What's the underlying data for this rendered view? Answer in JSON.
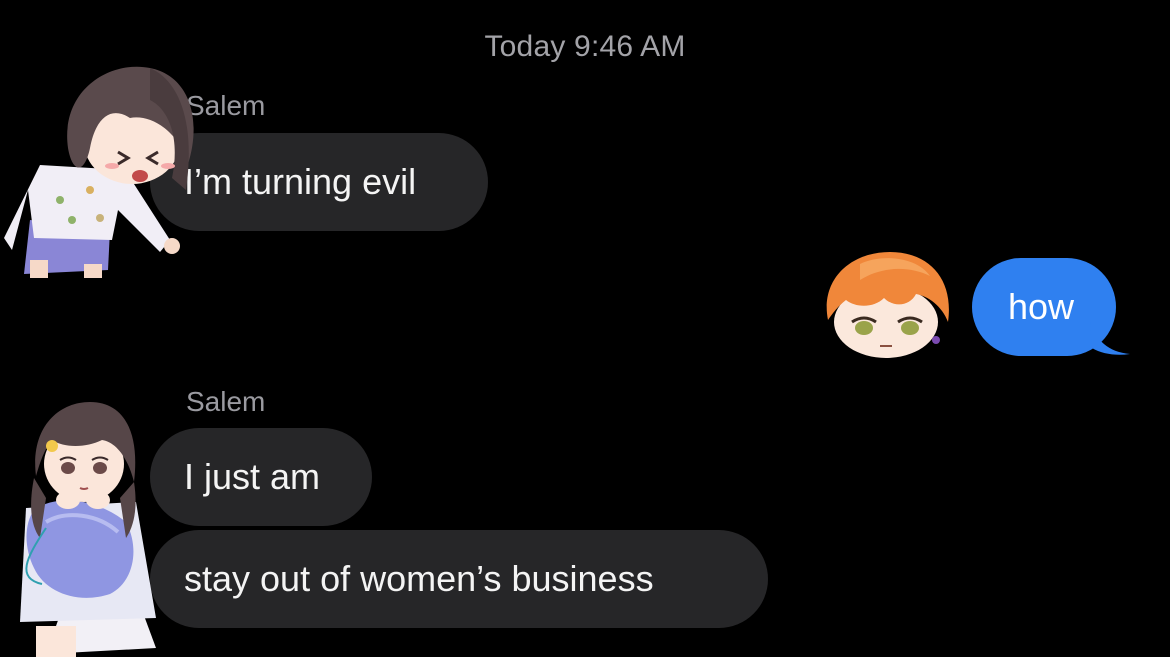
{
  "conversation": {
    "timestamp": "Today 9:46 AM",
    "messages": [
      {
        "sender": "Salem",
        "text": "I’m turning evil",
        "direction": "incoming"
      },
      {
        "text": "how",
        "direction": "outgoing"
      },
      {
        "sender": "Salem",
        "text": "I just am",
        "direction": "incoming"
      },
      {
        "text": "stay out of women’s business",
        "direction": "incoming"
      }
    ]
  },
  "colors": {
    "background": "#000000",
    "incoming_bubble": "#262628",
    "outgoing_bubble": "#2f80f0",
    "sender_label": "#9a9aa0",
    "timestamp": "#a3a3a8"
  },
  "stickers": [
    {
      "name": "anime-girl-crying-sticker",
      "note": "chibi girl with dark bob hair in pajamas"
    },
    {
      "name": "anime-boy-orange-hair-sticker",
      "note": "chibi head with orange hair"
    },
    {
      "name": "anime-girl-pillow-sticker",
      "note": "girl hugging a pillow"
    }
  ]
}
